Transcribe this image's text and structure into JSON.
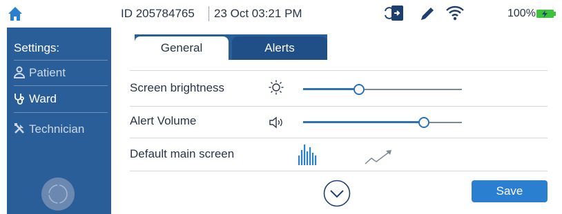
{
  "status_bar": {
    "device_id": "ID 205784765",
    "datetime": "23 Oct  03:21 PM",
    "battery": "100%",
    "icons": [
      "home-icon",
      "sync-icon",
      "pen-icon",
      "wifi-icon",
      "battery-charging-icon"
    ]
  },
  "sidebar": {
    "title": "Settings:",
    "items": [
      {
        "label": "Patient",
        "icon": "person-icon"
      },
      {
        "label": "Ward",
        "icon": "stethoscope-icon"
      },
      {
        "label": "Technician",
        "icon": "tools-icon"
      }
    ],
    "active": "Ward"
  },
  "tabs": [
    {
      "label": "General",
      "active": true
    },
    {
      "label": "Alerts",
      "active": false
    }
  ],
  "settings": {
    "brightness": {
      "label": "Screen brightness",
      "icon": "sun-icon",
      "level": 0.35
    },
    "volume": {
      "label": "Alert Volume",
      "icon": "speaker-icon",
      "level": 0.76
    },
    "main_screen": {
      "label": "Default main screen",
      "options": [
        "bar-chart-icon",
        "trend-line-icon"
      ]
    }
  },
  "actions": {
    "save_label": "Save",
    "scroll_down_icon": "chevron-down-circle-icon"
  },
  "colors": {
    "sidebar": "#2a5e99",
    "accent": "#2a7fd1",
    "battery": "#3cc23c"
  }
}
